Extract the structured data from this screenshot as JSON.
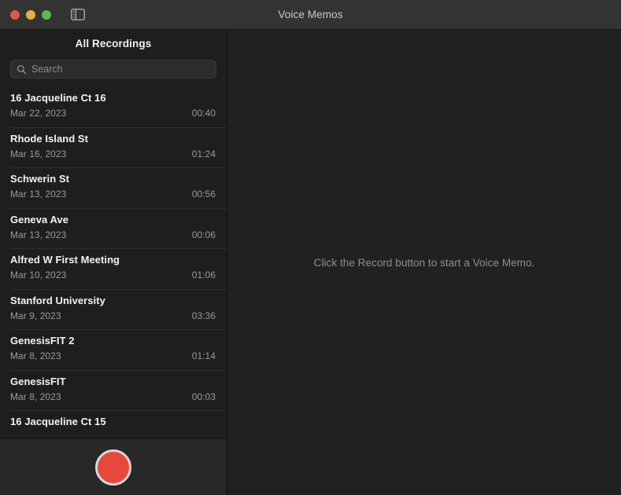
{
  "window": {
    "title": "Voice Memos",
    "traffic_lights": [
      {
        "name": "close",
        "color": "#e1564c"
      },
      {
        "name": "minimize",
        "color": "#e6b143"
      },
      {
        "name": "zoom",
        "color": "#56bd50"
      }
    ],
    "sidebar_toggle_icon": "sidebar-toggle-icon"
  },
  "sidebar": {
    "header": "All Recordings",
    "search": {
      "placeholder": "Search",
      "value": "",
      "icon": "search-icon"
    },
    "recordings": [
      {
        "title": "16 Jacqueline Ct 16",
        "date": "Mar 22, 2023",
        "duration": "00:40"
      },
      {
        "title": "Rhode Island St",
        "date": "Mar 16, 2023",
        "duration": "01:24"
      },
      {
        "title": "Schwerin St",
        "date": "Mar 13, 2023",
        "duration": "00:56"
      },
      {
        "title": "Geneva Ave",
        "date": "Mar 13, 2023",
        "duration": "00:06"
      },
      {
        "title": "Alfred W First Meeting",
        "date": "Mar 10, 2023",
        "duration": "01:06"
      },
      {
        "title": "Stanford University",
        "date": "Mar 9, 2023",
        "duration": "03:36"
      },
      {
        "title": "GenesisFIT 2",
        "date": "Mar 8, 2023",
        "duration": "01:14"
      },
      {
        "title": "GenesisFIT",
        "date": "Mar 8, 2023",
        "duration": "00:03"
      },
      {
        "title": "16 Jacqueline Ct 15",
        "date": "",
        "duration": ""
      }
    ],
    "record_button": {
      "name": "record-button",
      "color": "#e8483c"
    }
  },
  "detail": {
    "empty_message": "Click the Record button to start a Voice Memo."
  }
}
